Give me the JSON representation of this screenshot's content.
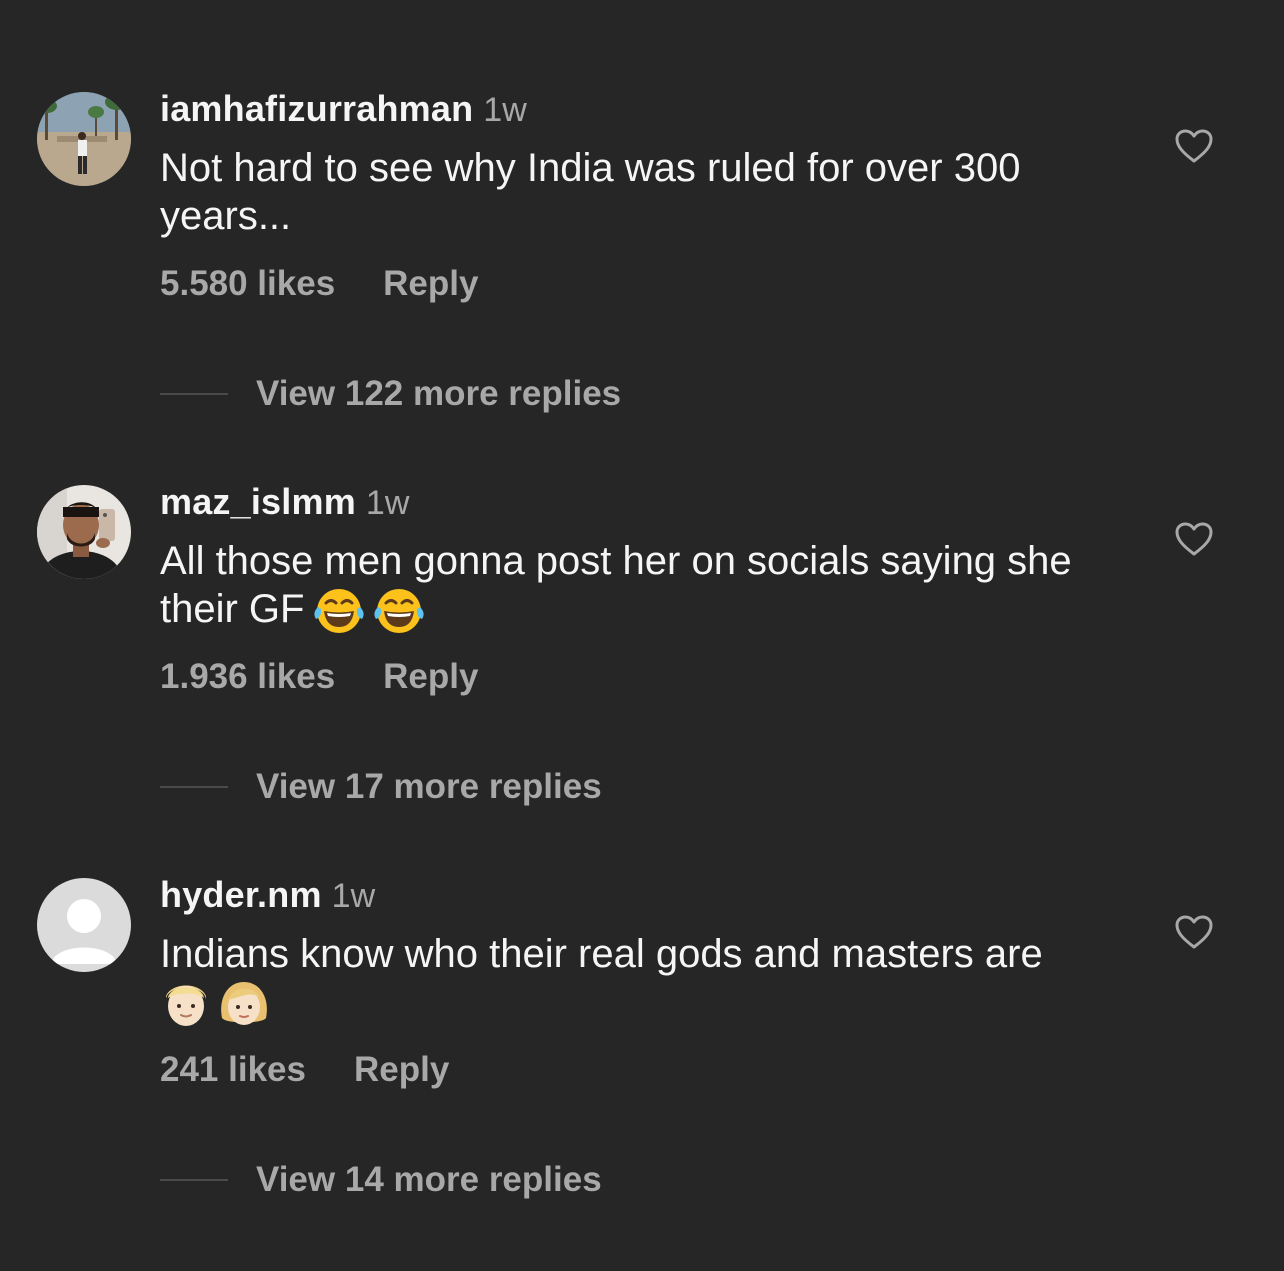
{
  "icons": {
    "like": "heart-outline-icon",
    "avatar_placeholder": "default-avatar-icon",
    "emoji_joy": "face-with-tears-of-joy-emoji",
    "emoji_blond_man": "blond-man-emoji",
    "emoji_blond_woman": "blond-woman-emoji"
  },
  "colors": {
    "background": "#262626",
    "primary_text": "#f5f5f5",
    "secondary_text": "#a8a8a8",
    "divider": "#4a4a4a"
  },
  "comments": [
    {
      "username": "iamhafizurrahman",
      "time": "1w",
      "text": "Not hard to see why India was ruled for over 300 years...",
      "emojis": [],
      "likes": "5.580 likes",
      "reply_label": "Reply",
      "view_replies": "View 122 more replies"
    },
    {
      "username": "maz_islmm",
      "time": "1w",
      "text": "All those men gonna post her on socials saying she their GF",
      "emojis": [
        "😂",
        "😂"
      ],
      "likes": "1.936 likes",
      "reply_label": "Reply",
      "view_replies": "View 17 more replies"
    },
    {
      "username": "hyder.nm",
      "time": "1w",
      "text": "Indians know who their real gods and masters are",
      "emojis": [
        "👱🏻‍♂️",
        "👱🏼‍♀️"
      ],
      "likes": "241 likes",
      "reply_label": "Reply",
      "view_replies": "View 14 more replies"
    }
  ]
}
